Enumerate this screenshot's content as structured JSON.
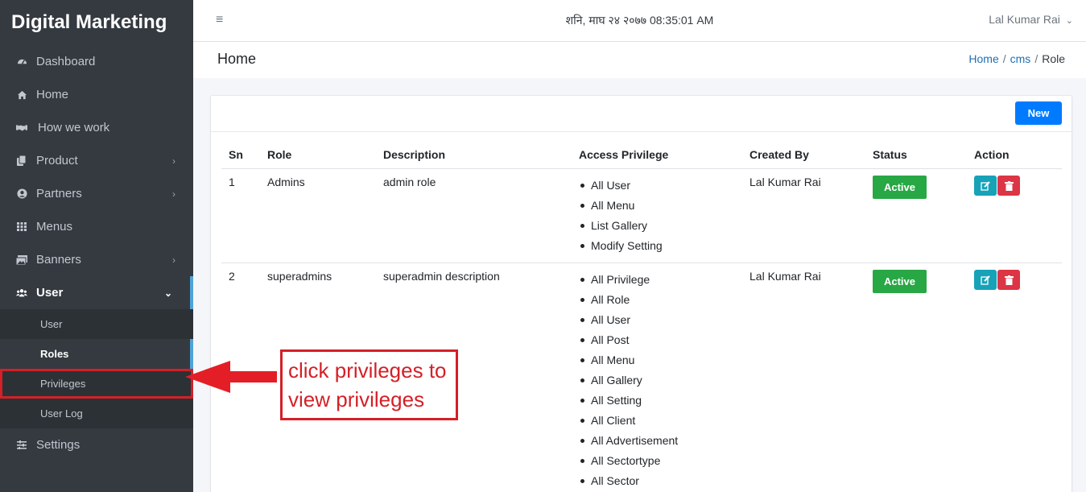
{
  "sidebar": {
    "brand": "Digital Marketing",
    "items": [
      {
        "label": "Dashboard",
        "icon": "dashboard-icon"
      },
      {
        "label": "Home",
        "icon": "home-icon"
      },
      {
        "label": "How we work",
        "icon": "handshake-icon"
      },
      {
        "label": "Product",
        "icon": "copy-icon",
        "has_children": true
      },
      {
        "label": "Partners",
        "icon": "user-circle-icon",
        "has_children": true
      },
      {
        "label": "Menus",
        "icon": "grid-icon"
      },
      {
        "label": "Banners",
        "icon": "images-icon",
        "has_children": true
      },
      {
        "label": "User",
        "icon": "users-icon",
        "expanded": true
      },
      {
        "label": "Settings",
        "icon": "sliders-icon"
      }
    ],
    "user_sub": [
      {
        "label": "User"
      },
      {
        "label": "Roles",
        "active": true
      },
      {
        "label": "Privileges"
      },
      {
        "label": "User Log"
      }
    ]
  },
  "topbar": {
    "datetime": "शनि, माघ २४ २०७७ 08:35:01 AM",
    "user_name": "Lal Kumar Rai"
  },
  "header": {
    "title": "Home",
    "breadcrumb": [
      "Home",
      "cms",
      "Role"
    ]
  },
  "card": {
    "new_label": "New"
  },
  "table": {
    "columns": [
      "Sn",
      "Role",
      "Description",
      "Access Privilege",
      "Created By",
      "Status",
      "Action"
    ],
    "rows": [
      {
        "sn": "1",
        "role": "Admins",
        "description": "admin role",
        "privileges": [
          "All User",
          "All Menu",
          "List Gallery",
          "Modify Setting"
        ],
        "created_by": "Lal Kumar Rai",
        "status": "Active"
      },
      {
        "sn": "2",
        "role": "superadmins",
        "description": "superadmin description",
        "privileges": [
          "All Privilege",
          "All Role",
          "All User",
          "All Post",
          "All Menu",
          "All Gallery",
          "All Setting",
          "All Client",
          "All Advertisement",
          "All Sectortype",
          "All Sector"
        ],
        "created_by": "Lal Kumar Rai",
        "status": "Active"
      }
    ]
  },
  "annotation": {
    "line1": "click privileges to",
    "line2": "view privileges"
  },
  "colors": {
    "sidebar_bg": "#343a40",
    "accent": "#007bff",
    "status_active": "#28a745",
    "edit": "#17a2b8",
    "delete": "#dc3545",
    "annotation": "#d42027"
  }
}
